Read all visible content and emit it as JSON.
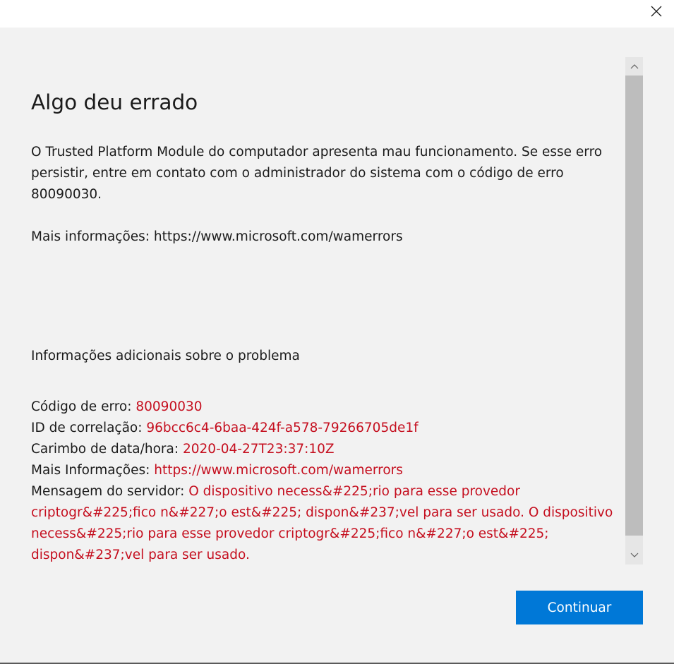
{
  "window": {
    "close_icon": "close-icon"
  },
  "dialog": {
    "title": "Algo deu errado",
    "message": "O Trusted Platform Module do computador apresenta mau funcionamento. Se esse erro persistir, entre em contato com o administrador do sistema com o código de erro 80090030.",
    "more_info": "Mais informações: https://www.microsoft.com/wamerrors",
    "additional_heading": "Informações adicionais sobre o problema",
    "details": {
      "error_code_label": "Código de erro: ",
      "error_code_value": "80090030",
      "correlation_label": "ID de correlação: ",
      "correlation_value": "96bcc6c4-6baa-424f-a578-79266705de1f",
      "timestamp_label": "Carimbo de data/hora: ",
      "timestamp_value": "2020-04-27T23:37:10Z",
      "more_info_label": "Mais Informações: ",
      "more_info_value": "https://www.microsoft.com/wamerrors",
      "server_message_label": "Mensagem do servidor: ",
      "server_message_value": "O dispositivo necess&#225;rio para esse provedor criptogr&#225;fico n&#227;o est&#225; dispon&#237;vel para ser usado. O dispositivo necess&#225;rio para esse provedor criptogr&#225;fico n&#227;o est&#225; dispon&#237;vel para ser usado."
    },
    "continue_label": "Continuar"
  },
  "colors": {
    "accent": "#0078d7",
    "error_text": "#c50f1f",
    "background": "#f2f2f2"
  }
}
